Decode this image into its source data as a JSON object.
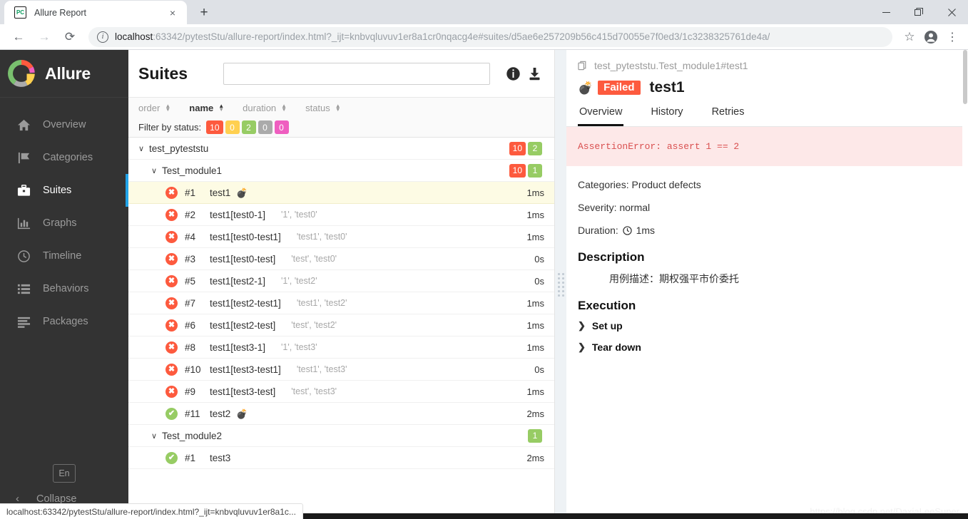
{
  "browser": {
    "tab": {
      "favicon_text": "PC",
      "title": "Allure Report",
      "close_icon": "×"
    },
    "newtab_label": "+",
    "window_controls": {
      "minimize": "─",
      "restore": "❐",
      "close": "✕"
    },
    "nav": {
      "back": "←",
      "forward": "→",
      "reload": "⟳"
    },
    "url_host": "localhost",
    "url_rest": ":63342/pytestStu/allure-report/index.html?_ijt=knbvqluvuv1er8a1cr0nqacg4e#suites/d5ae6e257209b56c415d70055e7f0ed3/1c3238325761de4a/",
    "bookmark_icon": "☆",
    "profile_icon": "profile-icon",
    "menu_icon": "⋮"
  },
  "sidebar": {
    "brand": "Allure",
    "items": [
      {
        "label": "Overview",
        "icon": "home-icon",
        "active": false
      },
      {
        "label": "Categories",
        "icon": "flag-icon",
        "active": false
      },
      {
        "label": "Suites",
        "icon": "briefcase-icon",
        "active": true
      },
      {
        "label": "Graphs",
        "icon": "bar-chart-icon",
        "active": false
      },
      {
        "label": "Timeline",
        "icon": "clock-icon",
        "active": false
      },
      {
        "label": "Behaviors",
        "icon": "list-icon",
        "active": false
      },
      {
        "label": "Packages",
        "icon": "layers-icon",
        "active": false
      }
    ],
    "language_chip": "En",
    "collapse_label": "Collapse",
    "collapse_chevron": "‹"
  },
  "suites": {
    "title": "Suites",
    "search_value": "",
    "search_placeholder": "",
    "info_icon": "info-icon",
    "download_icon": "download-icon",
    "sort_columns": [
      {
        "label": "order",
        "active": false
      },
      {
        "label": "name",
        "active": true
      },
      {
        "label": "duration",
        "active": false
      },
      {
        "label": "status",
        "active": false
      }
    ],
    "filter_label": "Filter by status:",
    "filter_badges": [
      {
        "count": "10",
        "color": "#fd5a3e",
        "status": "failed"
      },
      {
        "count": "0",
        "color": "#ffd050",
        "status": "broken"
      },
      {
        "count": "2",
        "color": "#97cc64",
        "status": "passed"
      },
      {
        "count": "0",
        "color": "#aaaaaa",
        "status": "skipped"
      },
      {
        "count": "0",
        "color": "#ef5ec0",
        "status": "unknown"
      }
    ],
    "tree": [
      {
        "kind": "group",
        "level": 0,
        "label": "test_pyteststu",
        "expanded": true,
        "badges": [
          {
            "count": "10",
            "color": "#fd5a3e"
          },
          {
            "count": "2",
            "color": "#97cc64"
          }
        ]
      },
      {
        "kind": "group",
        "level": 1,
        "label": "Test_module1",
        "expanded": true,
        "badges": [
          {
            "count": "10",
            "color": "#fd5a3e"
          },
          {
            "count": "1",
            "color": "#97cc64"
          }
        ]
      },
      {
        "kind": "test",
        "status": "failed",
        "order": "#1",
        "name": "test1",
        "params": "",
        "bomb": true,
        "duration": "1ms",
        "selected": true
      },
      {
        "kind": "test",
        "status": "failed",
        "order": "#2",
        "name": "test1[test0-1]",
        "params": "'1', 'test0'",
        "bomb": false,
        "duration": "1ms",
        "selected": false
      },
      {
        "kind": "test",
        "status": "failed",
        "order": "#4",
        "name": "test1[test0-test1]",
        "params": "'test1', 'test0'",
        "bomb": false,
        "duration": "1ms",
        "selected": false
      },
      {
        "kind": "test",
        "status": "failed",
        "order": "#3",
        "name": "test1[test0-test]",
        "params": "'test', 'test0'",
        "bomb": false,
        "duration": "0s",
        "selected": false
      },
      {
        "kind": "test",
        "status": "failed",
        "order": "#5",
        "name": "test1[test2-1]",
        "params": "'1', 'test2'",
        "bomb": false,
        "duration": "0s",
        "selected": false
      },
      {
        "kind": "test",
        "status": "failed",
        "order": "#7",
        "name": "test1[test2-test1]",
        "params": "'test1', 'test2'",
        "bomb": false,
        "duration": "1ms",
        "selected": false
      },
      {
        "kind": "test",
        "status": "failed",
        "order": "#6",
        "name": "test1[test2-test]",
        "params": "'test', 'test2'",
        "bomb": false,
        "duration": "1ms",
        "selected": false
      },
      {
        "kind": "test",
        "status": "failed",
        "order": "#8",
        "name": "test1[test3-1]",
        "params": "'1', 'test3'",
        "bomb": false,
        "duration": "1ms",
        "selected": false
      },
      {
        "kind": "test",
        "status": "failed",
        "order": "#10",
        "name": "test1[test3-test1]",
        "params": "'test1', 'test3'",
        "bomb": false,
        "duration": "0s",
        "selected": false
      },
      {
        "kind": "test",
        "status": "failed",
        "order": "#9",
        "name": "test1[test3-test]",
        "params": "'test', 'test3'",
        "bomb": false,
        "duration": "1ms",
        "selected": false
      },
      {
        "kind": "test",
        "status": "passed",
        "order": "#11",
        "name": "test2",
        "params": "",
        "bomb": true,
        "duration": "2ms",
        "selected": false
      },
      {
        "kind": "group",
        "level": 1,
        "label": "Test_module2",
        "expanded": true,
        "badges": [
          {
            "count": "1",
            "color": "#97cc64"
          }
        ]
      },
      {
        "kind": "test",
        "status": "passed",
        "order": "#1",
        "name": "test3",
        "params": "",
        "bomb": false,
        "duration": "2ms",
        "selected": false
      }
    ]
  },
  "detail": {
    "breadcrumb": "test_pyteststu.Test_module1#test1",
    "copy_icon": "copy-icon",
    "status_tag": "Failed",
    "bomb_icon": "bomb-icon",
    "test_name": "test1",
    "tabs": [
      {
        "label": "Overview",
        "active": true
      },
      {
        "label": "History",
        "active": false
      },
      {
        "label": "Retries",
        "active": false
      }
    ],
    "error_message": "AssertionError: assert 1 == 2",
    "meta": [
      "Categories: Product defects",
      "Severity: normal"
    ],
    "duration_label": "Duration:",
    "duration_value": "1ms",
    "description_heading": "Description",
    "description_text": "用例描述：期权强平市价委托",
    "execution_heading": "Execution",
    "execution_items": [
      {
        "label": "Set up",
        "expanded": false
      },
      {
        "label": "Tear down",
        "expanded": false
      }
    ],
    "watermark": "https://blog.csdn.net/DaxiaLeeSuper"
  },
  "statusbar": {
    "text": "localhost:63342/pytestStu/allure-report/index.html?_ijt=knbvqluvuv1er8a1c..."
  },
  "colors": {
    "failed": "#fd5a3e",
    "passed": "#97cc64",
    "accent": "#21a3e8",
    "sidebar_bg": "#333333",
    "selected_row": "#fdfbe4",
    "error_bg": "#fde8e8"
  }
}
